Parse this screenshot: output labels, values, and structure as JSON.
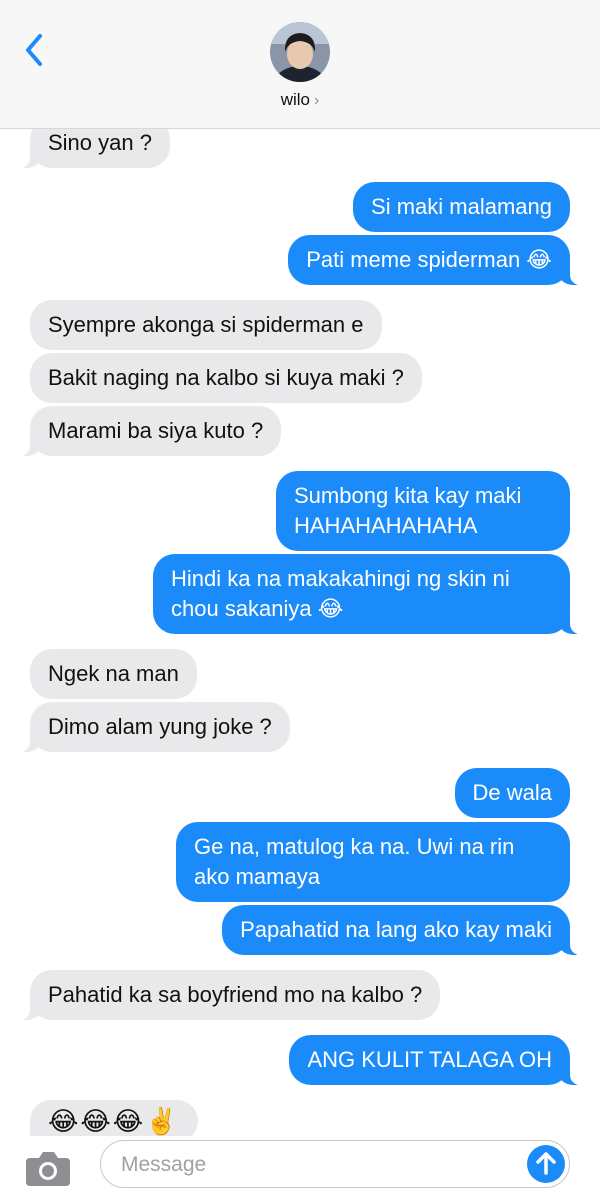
{
  "header": {
    "contact_name": "wilo",
    "chevron": "›"
  },
  "messages": [
    {
      "side": "in",
      "text": "Sino yan ?"
    },
    {
      "side": "out",
      "text": "Si maki malamang"
    },
    {
      "side": "out",
      "text": "Pati meme spiderman 😂"
    },
    {
      "side": "in",
      "text": "Syempre akonga si spiderman e"
    },
    {
      "side": "in",
      "text": "Bakit naging na kalbo si kuya maki ?"
    },
    {
      "side": "in",
      "text": "Marami ba siya kuto ?"
    },
    {
      "side": "out",
      "text": "Sumbong kita kay maki HAHAHAHAHAHA"
    },
    {
      "side": "out",
      "text": "Hindi ka na makakahingi ng skin ni chou sakaniya 😂"
    },
    {
      "side": "in",
      "text": "Ngek na man"
    },
    {
      "side": "in",
      "text": "Dimo alam yung joke ?"
    },
    {
      "side": "out",
      "text": "De wala"
    },
    {
      "side": "out",
      "text": "Ge na, matulog ka na. Uwi na rin ako mamaya"
    },
    {
      "side": "out",
      "text": "Papahatid na lang ako kay maki"
    },
    {
      "side": "in",
      "text": "Pahatid ka sa boyfriend mo na kalbo ?"
    },
    {
      "side": "out",
      "text": "ANG KULIT TALAGA OH"
    },
    {
      "side": "in",
      "text": "😂😂😂✌️"
    }
  ],
  "input": {
    "placeholder": "Message"
  },
  "colors": {
    "outgoing": "#1b8bfa",
    "incoming": "#e9e9eb",
    "accent": "#1b8bfa"
  },
  "icons": {
    "back": "chevron-left-icon",
    "camera": "camera-icon",
    "send": "arrow-up-icon"
  }
}
